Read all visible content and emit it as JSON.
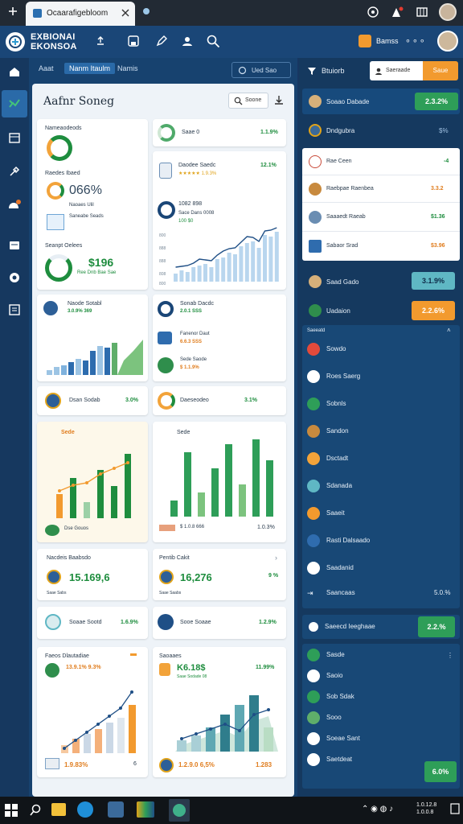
{
  "browser": {
    "tab_title": "Ocaarafigebloom"
  },
  "app": {
    "brand_line1": "EXBIONAI",
    "brand_line2": "EKONSOA",
    "user_label": "Bamss"
  },
  "subtabs": [
    "Aaat",
    "Nanm Itaulm",
    "Namis"
  ],
  "sub_action": "Ued Sao",
  "search": {
    "title": "Aafnr Soneg",
    "button": "Soone"
  },
  "cards": {
    "c1": {
      "title": "Nameaodeods",
      "sub1": "Raedes Ibaed",
      "pct": "066%",
      "sub2": "Naoaes Ulil",
      "sub3": "Saneabe Seads",
      "sub4": "Seanpt Oelees",
      "val": "$196",
      "foot": "Ree Dnb Bae Sae"
    },
    "c2": {
      "label": "Saae 0",
      "pct": "1.1.9%"
    },
    "c3": {
      "title": "Daodee Saedc",
      "stars": "1.9.3%",
      "pct": "12.1%",
      "s2": "1082 898",
      "s3": "Sace Dans 0008"
    },
    "c3_ticks": [
      "800",
      "888",
      "888",
      "808",
      "800"
    ],
    "c4": {
      "title": "Naode Sotabl",
      "sub": "3.0.9% 369"
    },
    "c5": {
      "r1": "Sonab Dacdc",
      "r1v": "2.0.1 SSS",
      "r2": "Fanenor Daut",
      "r2v": "6.6.3 SSS",
      "r3": "Sede Saode",
      "r3v": "$ 1.1.9%"
    },
    "c6": {
      "label": "Dsan Sodab",
      "pct": "3.0%"
    },
    "c7": {
      "label": "Daeseodeo",
      "pct": "3.1%"
    },
    "c8": {
      "title": "Sede",
      "foot": "Dse Gouos"
    },
    "c9": {
      "title": "Sede",
      "foot": "$ 1.0.8 666",
      "val": "1.0.3%"
    },
    "c10": {
      "title": "Nacdeis Baabsdo",
      "val": "15.169,6",
      "foot": "Saae Sabs"
    },
    "c11": {
      "title": "Pentib Cakit",
      "val": "16,276",
      "pct": "9 %",
      "foot": "Saae Saabs"
    },
    "c12": {
      "label": "Soaae Sootd",
      "pct": "1.6.9%"
    },
    "c13": {
      "label": "Sooe Soaae",
      "pct": "1.2.9%"
    },
    "c14": {
      "title": "Faeos Dlautadiae",
      "val": "13.9.1% 9.3%",
      "foot1": "1.9.83%",
      "foot2": "6"
    },
    "c15": {
      "title": "Saoaaes",
      "val": "K6.18$",
      "pct": "11.99%",
      "s": "Saae Sodade 08",
      "foot1": "1.2.9.0 6,5%",
      "foot2": "1.283"
    }
  },
  "right": {
    "title": "Btuiorb",
    "search_placeholder": "Saeraade",
    "action": "Saue",
    "items": [
      {
        "label": "Soaao Dabade",
        "value": "2.3.2%"
      },
      {
        "label": "Dndgubra",
        "value": "$%"
      },
      {
        "label": "Rae Ceen",
        "value": "-4"
      },
      {
        "label": "Raebpae Raenbea",
        "value": "3.3.2"
      },
      {
        "label": "Saaaedt Raeab",
        "value": "$1.36"
      },
      {
        "label": "Sabaor Srad",
        "value": "$3.96"
      },
      {
        "label": "Saad Gado",
        "value": "3.1.9%"
      },
      {
        "label": "Uadaion",
        "value": "2.2.6%"
      }
    ],
    "section": "Saeeatd",
    "list": [
      "Sowdo",
      "Roes Saerg",
      "Sobnls",
      "Sandon",
      "Dsctadt",
      "Sdanada",
      "Saaeit",
      "Rasti Dalsaado",
      "Saadanid"
    ],
    "list_foot": {
      "label": "Saancaas",
      "value": "5.0.%"
    },
    "card2": {
      "label": "Saeecd Ieeghaae",
      "value": "2.2.%"
    },
    "list2": [
      "Sasde",
      "Saoio",
      "Sob Sdak",
      "Sooo",
      "Soeae Sant",
      "Saetdeat"
    ],
    "list2_foot": "6.0%"
  },
  "taskbar": {
    "time": "1.0.12.8",
    "date": "1.0.0.8"
  },
  "colors": {
    "green": "#1e8d3e",
    "orange": "#f29a2e",
    "blue": "#1a4677",
    "teal": "#5fb7c4"
  }
}
